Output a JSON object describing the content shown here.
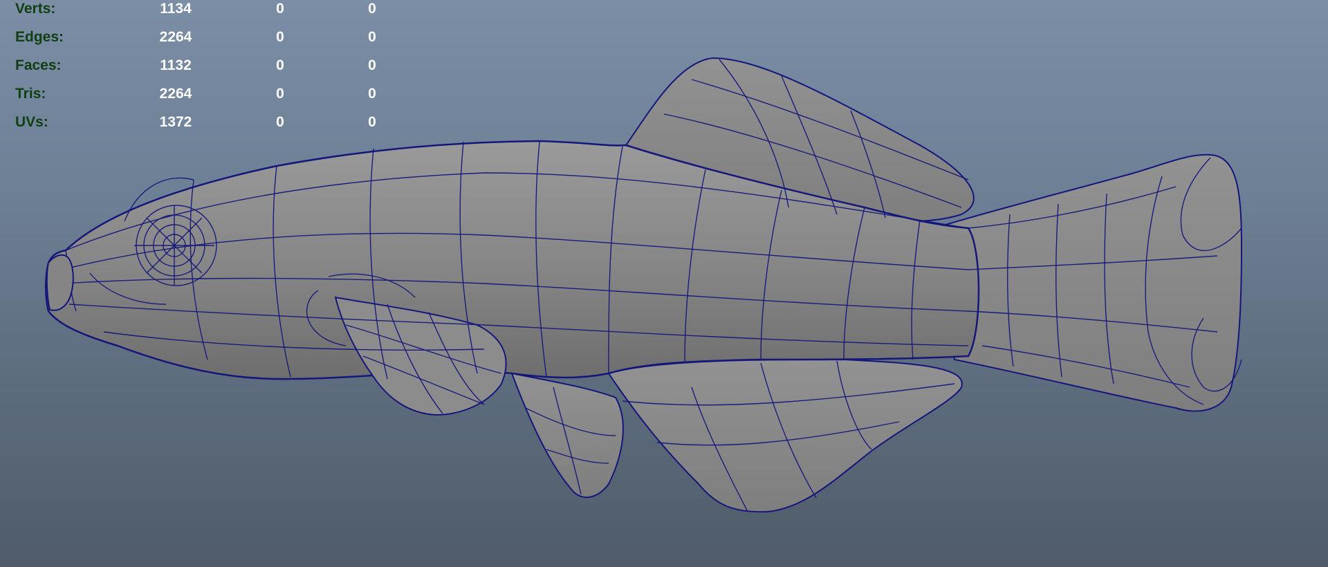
{
  "poly_count": {
    "rows": [
      {
        "label": "Verts:",
        "values": [
          "1134",
          "0",
          "0"
        ]
      },
      {
        "label": "Edges:",
        "values": [
          "2264",
          "0",
          "0"
        ]
      },
      {
        "label": "Faces:",
        "values": [
          "1132",
          "0",
          "0"
        ]
      },
      {
        "label": "Tris:",
        "values": [
          "2264",
          "0",
          "0"
        ]
      },
      {
        "label": "UVs:",
        "values": [
          "1372",
          "0",
          "0"
        ]
      }
    ]
  },
  "viewport": {
    "model_name": "fish-wireframe-model",
    "wire_color": "#14167a",
    "surface_color": "#8a8a8a",
    "label_color": "#0f3f12",
    "value_color": "#ffffff"
  }
}
